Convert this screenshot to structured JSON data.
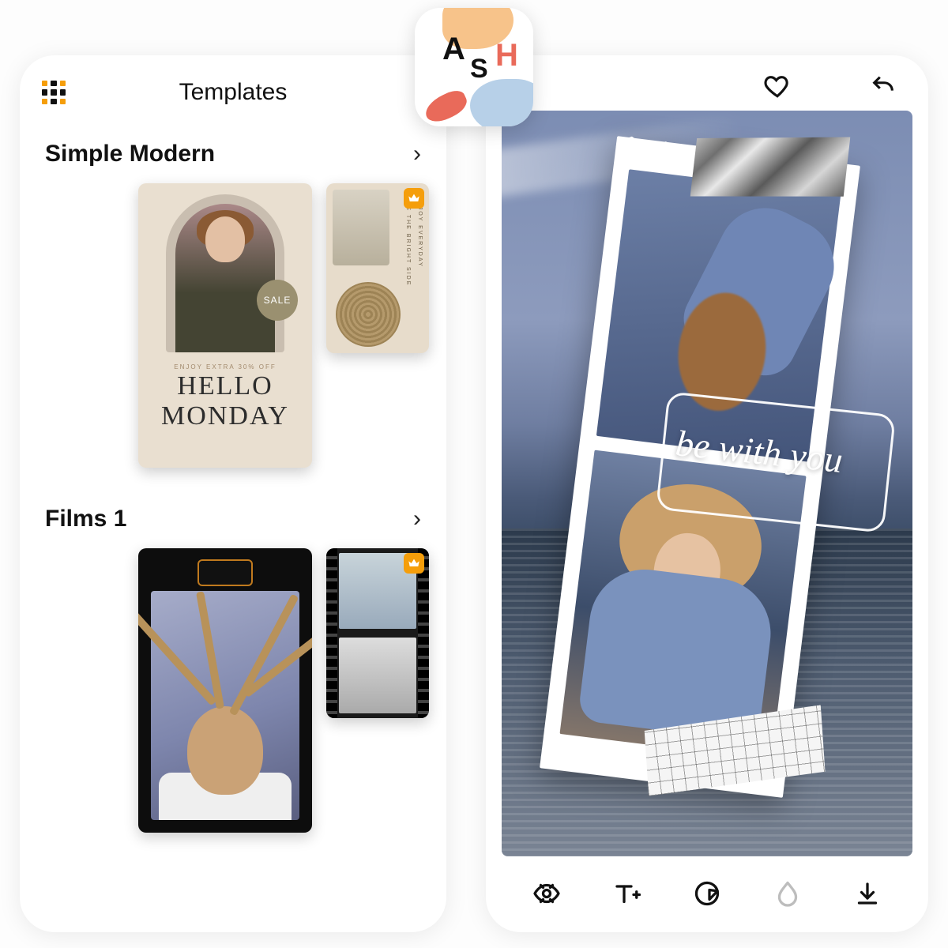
{
  "app": {
    "logo_letters": [
      "A",
      "S",
      "H"
    ]
  },
  "leftPanel": {
    "title": "Templates",
    "categories": [
      {
        "name": "Simple Modern",
        "items": [
          {
            "sale_badge": "SALE",
            "tagline": "ENJOY EXTRA 30% OFF",
            "headline1": "HELLO",
            "headline2": "MONDAY"
          },
          {
            "premium": true,
            "side_text1": "SEE THE BRIGHT SIDE",
            "side_text2": "ENJOY EVERYDAY"
          }
        ]
      },
      {
        "name": "Films 1",
        "items": [
          {
            "style": "polaroid-dark"
          },
          {
            "premium": true,
            "style": "film-strip"
          }
        ]
      }
    ]
  },
  "rightPanel": {
    "overlay_text": "be with you",
    "toolbar": [
      "preview",
      "text",
      "sticker",
      "blur",
      "download"
    ]
  }
}
